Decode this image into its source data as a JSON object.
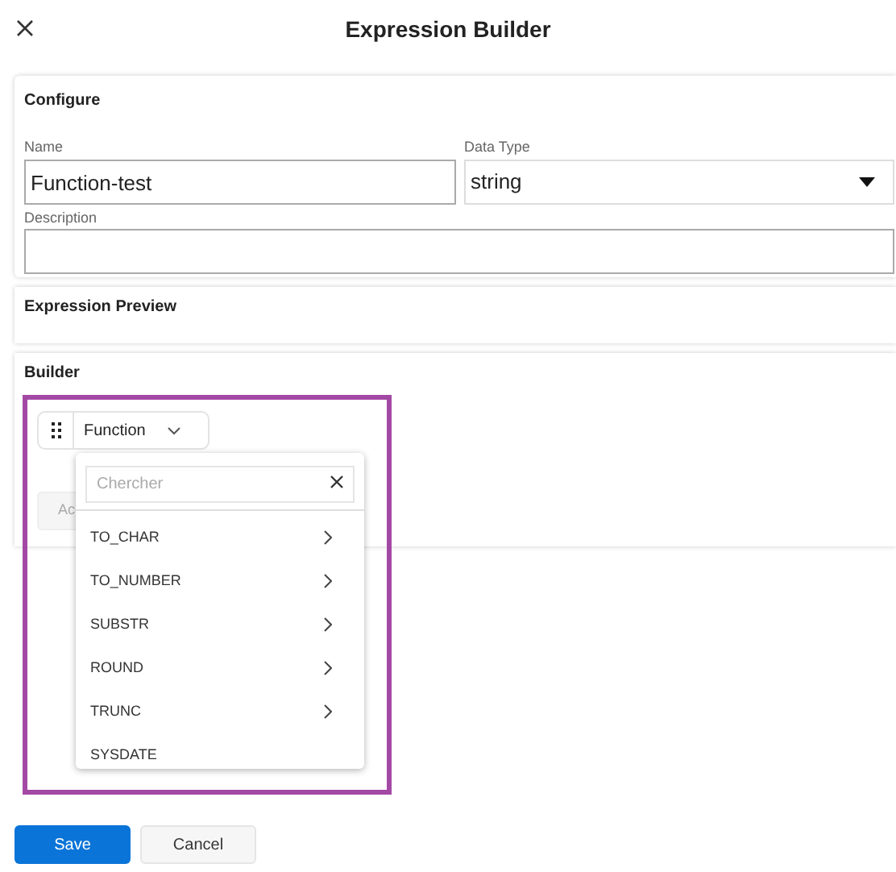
{
  "dialog": {
    "title": "Expression Builder"
  },
  "configure": {
    "heading": "Configure",
    "name": {
      "label": "Name",
      "value": "Function-test"
    },
    "data_type": {
      "label": "Data Type",
      "value": "string"
    },
    "description": {
      "label": "Description"
    }
  },
  "preview": {
    "heading": "Expression Preview"
  },
  "builder": {
    "heading": "Builder",
    "function_select": {
      "value": "Function"
    },
    "covered_button": "Ac",
    "dropdown": {
      "search_placeholder": "Chercher",
      "items": [
        {
          "label": "TO_CHAR",
          "has_submenu": true
        },
        {
          "label": "TO_NUMBER",
          "has_submenu": true
        },
        {
          "label": "SUBSTR",
          "has_submenu": true
        },
        {
          "label": "ROUND",
          "has_submenu": true
        },
        {
          "label": "TRUNC",
          "has_submenu": true
        },
        {
          "label": "SYSDATE",
          "has_submenu": false
        }
      ]
    }
  },
  "buttons": [
    {
      "label": "Save",
      "kind": "primary"
    },
    {
      "label": "Cancel",
      "kind": "secondary"
    }
  ]
}
